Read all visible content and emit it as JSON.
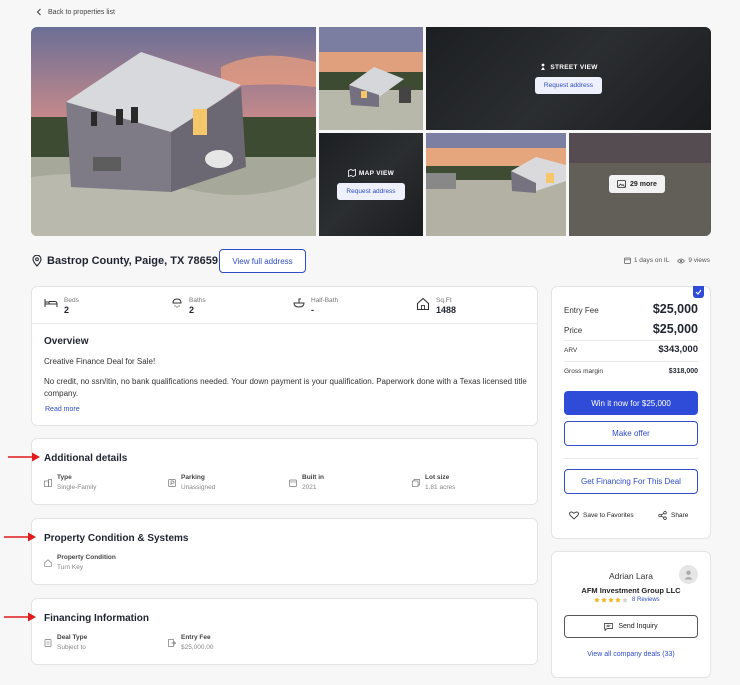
{
  "nav": {
    "back_label": "Back to properties list"
  },
  "gallery": {
    "street_view_label": "STREET VIEW",
    "map_view_label": "MAP VIEW",
    "request_address": "Request address",
    "more_photos": "29 more"
  },
  "property": {
    "address": "Bastrop County, Paige, TX 78659",
    "view_address": "View full address",
    "days_on": "1 days on IL",
    "views": "9 views"
  },
  "stats": [
    {
      "label": "Beds",
      "value": "2",
      "icon": "bed-icon"
    },
    {
      "label": "Baths",
      "value": "2",
      "icon": "shower-icon"
    },
    {
      "label": "Half-Bath",
      "value": "-",
      "icon": "sink-icon"
    },
    {
      "label": "Sq.Ft",
      "value": "1488",
      "icon": "house-icon"
    }
  ],
  "overview": {
    "title": "Overview",
    "line1": "Creative Finance Deal for Sale!",
    "line2": "No credit, no ssn/itin, no bank qualifications needed. Your down payment is your qualification. Paperwork done with a Texas licensed title company.",
    "read_more": "Read more"
  },
  "additional": {
    "title": "Additional details",
    "items": [
      {
        "label": "Type",
        "value": "Single-Family"
      },
      {
        "label": "Parking",
        "value": "Unassigned"
      },
      {
        "label": "Built in",
        "value": "2021"
      },
      {
        "label": "Lot size",
        "value": "1.81 acres"
      }
    ]
  },
  "condition": {
    "title": "Property Condition & Systems",
    "label": "Property Condition",
    "value": "Turn Key"
  },
  "financing": {
    "title": "Financing Information",
    "items": [
      {
        "label": "Deal Type",
        "value": "Subject to"
      },
      {
        "label": "Entry Fee",
        "value": "$25,000.00"
      }
    ]
  },
  "pricing": {
    "entry_fee_label": "Entry Fee",
    "entry_fee": "$25,000",
    "price_label": "Price",
    "price": "$25,000",
    "arv_label": "ARV",
    "arv": "$343,000",
    "margin_label": "Gross margin",
    "margin": "$318,000",
    "win_button": "Win it now for $25,000",
    "offer_button": "Make offer",
    "financing_button": "Get Financing For This Deal",
    "save_label": "Save to Favorites",
    "share_label": "Share"
  },
  "seller": {
    "name": "Adrian Lara",
    "company": "AFM Investment Group LLC",
    "rating": 4,
    "reviews": "8 Reviews",
    "inquiry_button": "Send Inquiry",
    "company_deals": "View all company deals (33)"
  },
  "colors": {
    "accent": "#2f4cd8",
    "annotation_arrow": "#e01b1b",
    "star": "#f2b01e"
  }
}
